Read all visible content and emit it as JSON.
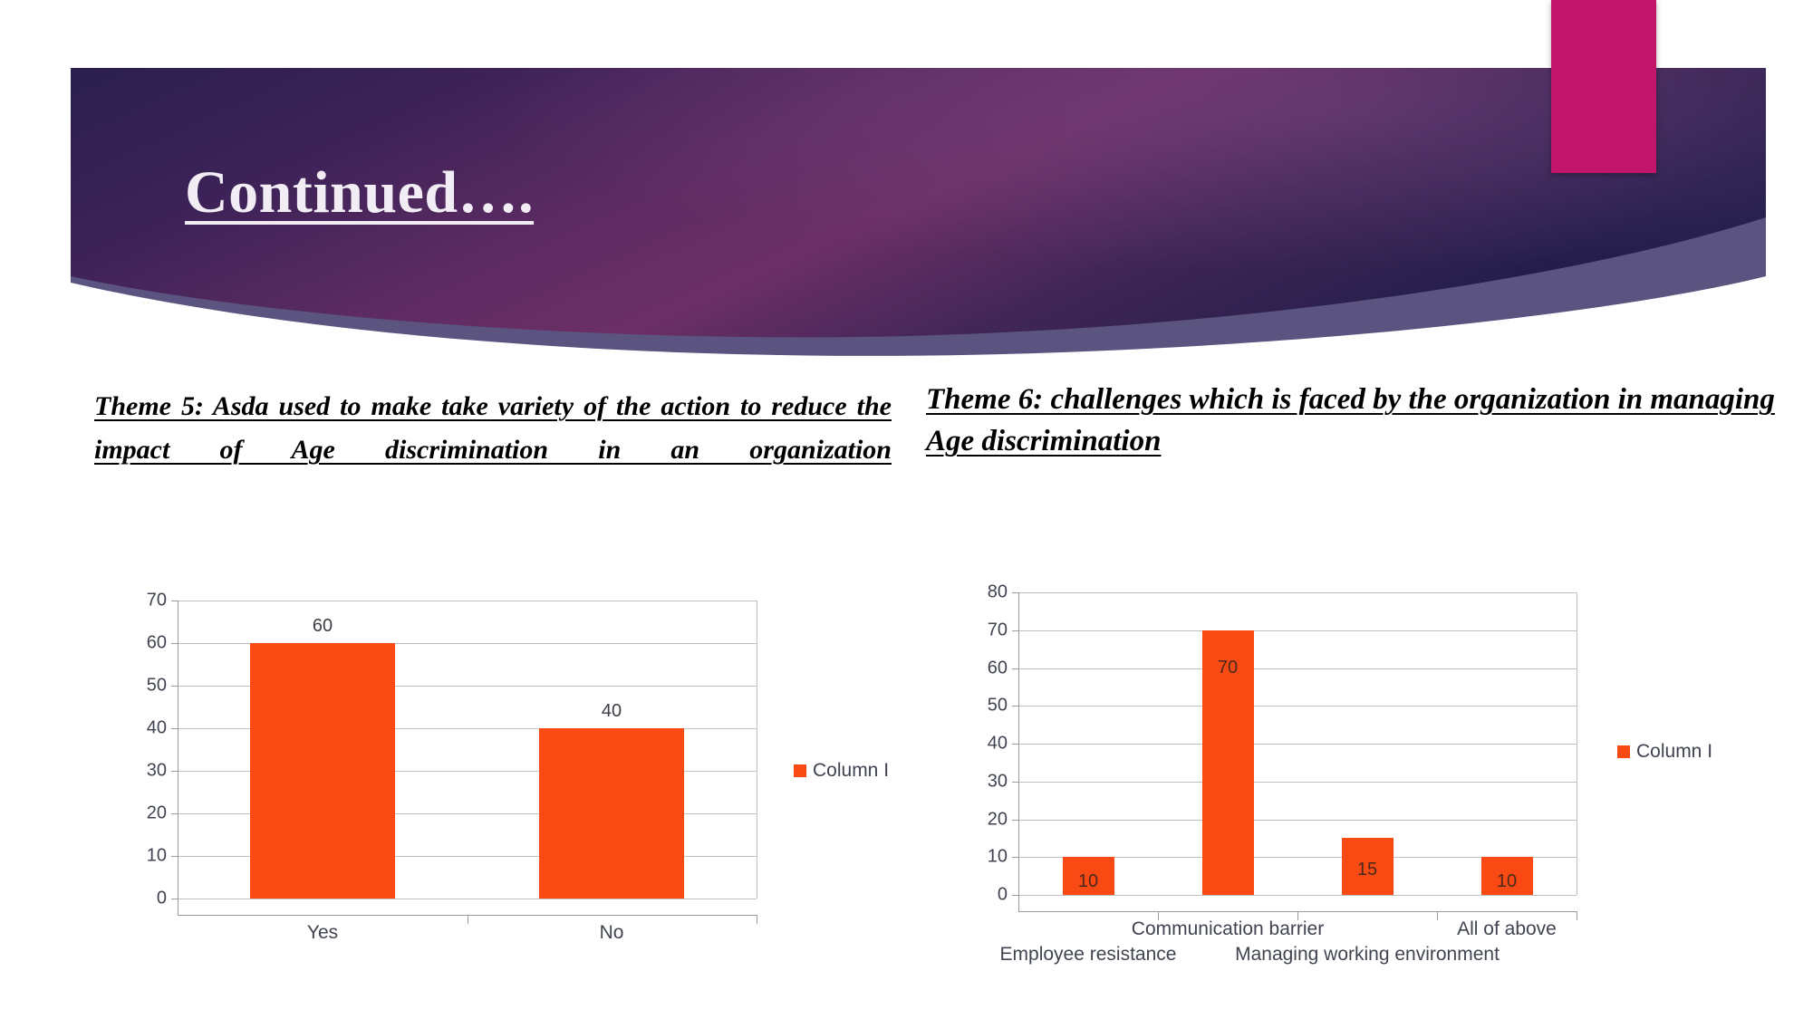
{
  "slide": {
    "title": "Continued….",
    "banner": {
      "gradient_left": "#2A1F4D",
      "gradient_mid": "#6B2F66",
      "gradient_right": "#2A2250",
      "swoosh_color": "#5B5480",
      "accent_color": "#C2166B",
      "title_color": "#F2EDF5"
    }
  },
  "content": {
    "theme5_heading": " Theme 5: Asda used to make take variety of the action to reduce the impact of Age discrimination in an organization",
    "theme6_heading": "Theme 6: challenges which is faced by the organization in managing Age discrimination"
  },
  "chart_data": [
    {
      "id": "theme5-chart",
      "type": "bar",
      "title": "",
      "xlabel": "",
      "ylabel": "",
      "categories": [
        "Yes",
        "No"
      ],
      "values": [
        60,
        40
      ],
      "series": [
        {
          "name": "Column I",
          "values": [
            60,
            40
          ]
        }
      ],
      "ylim": [
        0,
        70
      ],
      "ytick_labels": [
        "70",
        "60",
        "50",
        "40",
        "30",
        "20",
        "10",
        "0"
      ],
      "ytick_values": [
        70,
        60,
        50,
        40,
        30,
        20,
        10,
        0
      ],
      "grid": true,
      "legend": {
        "position": "right",
        "entries": [
          "Column I"
        ]
      },
      "bar_color": "#FA4A14",
      "data_labels": [
        "60",
        "40"
      ],
      "data_label_position": "outside"
    },
    {
      "id": "theme6-chart",
      "type": "bar",
      "title": "",
      "xlabel": "",
      "ylabel": "",
      "categories": [
        "Employee resistance",
        "Communication barrier",
        "Managing working environment",
        "All of above"
      ],
      "values": [
        10,
        70,
        15,
        10
      ],
      "series": [
        {
          "name": "Column I",
          "values": [
            10,
            70,
            15,
            10
          ]
        }
      ],
      "ylim": [
        0,
        80
      ],
      "ytick_labels": [
        "80",
        "70",
        "60",
        "50",
        "40",
        "30",
        "20",
        "10",
        "0"
      ],
      "ytick_values": [
        80,
        70,
        60,
        50,
        40,
        30,
        20,
        10,
        0
      ],
      "grid": true,
      "legend": {
        "position": "right",
        "entries": [
          "Column I"
        ]
      },
      "bar_color": "#FA4A14",
      "data_labels": [
        "10",
        "70",
        "15",
        "10"
      ],
      "data_label_position": "inside"
    }
  ]
}
